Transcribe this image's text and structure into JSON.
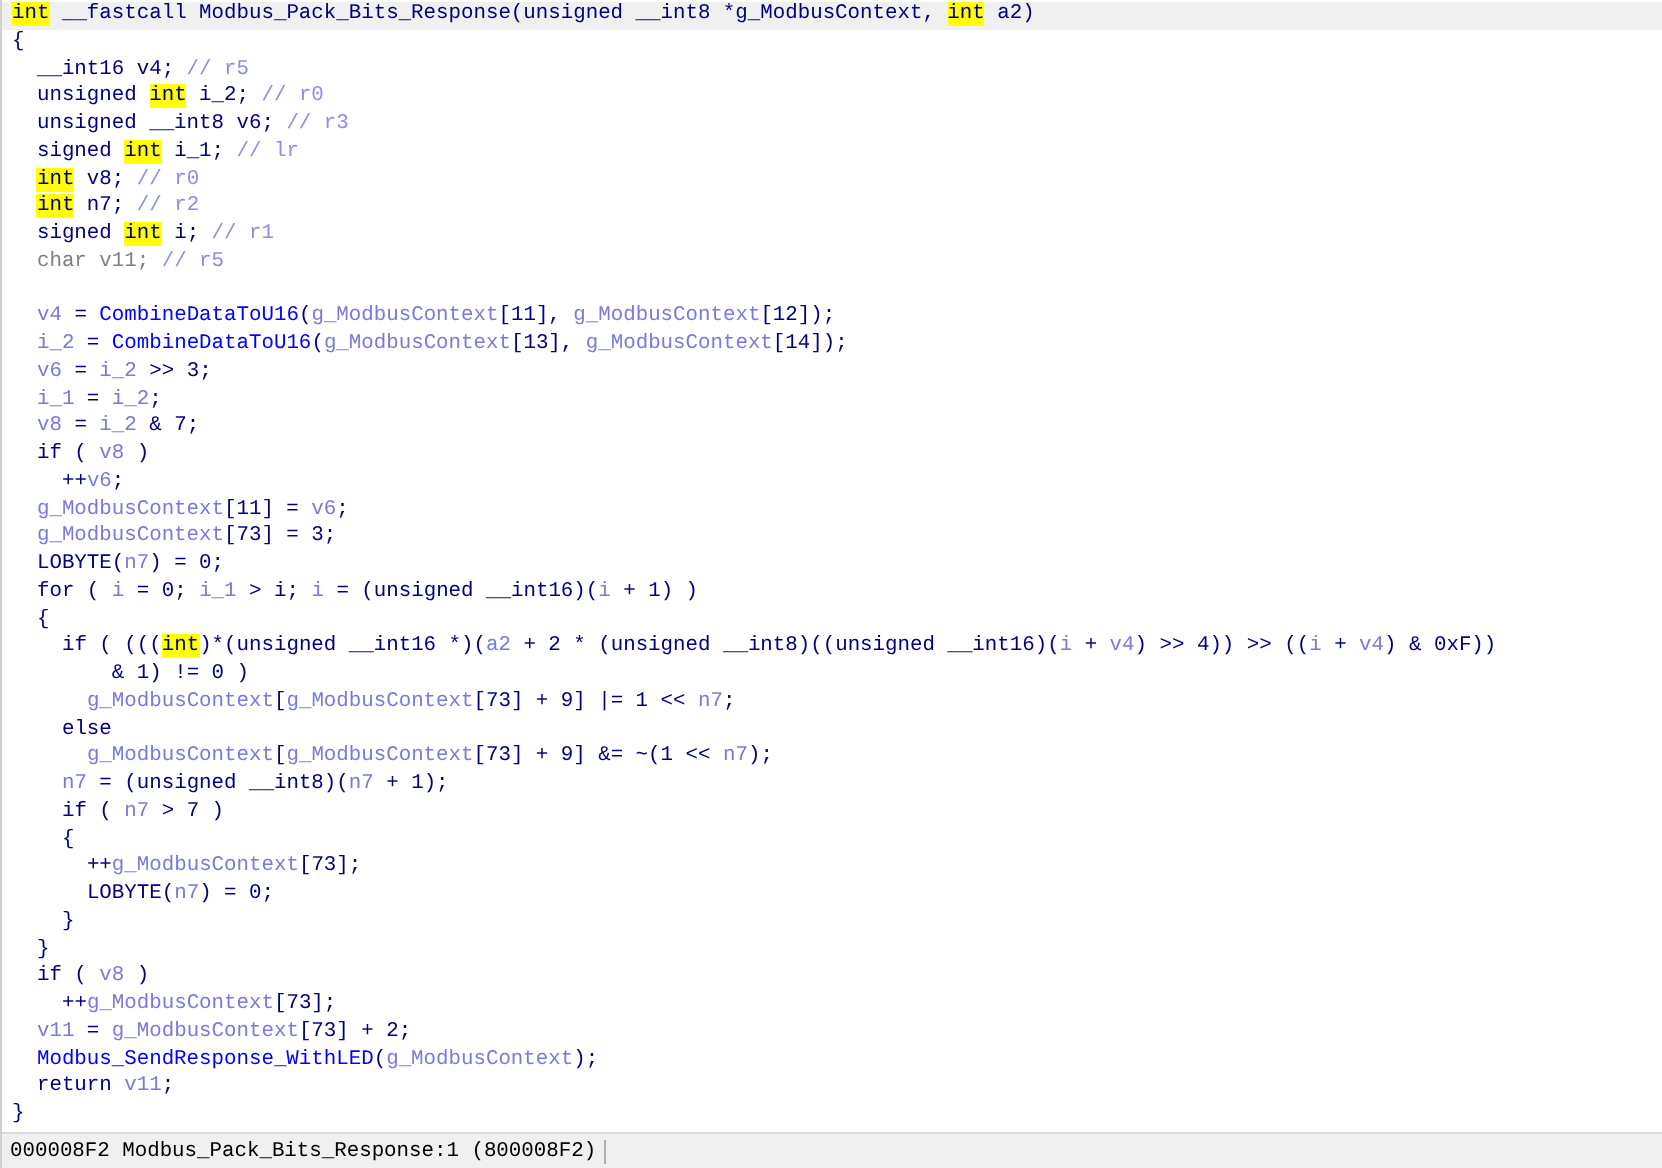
{
  "signature": {
    "selected": true,
    "tokens": [
      {
        "kind": "hl",
        "text": "int"
      },
      {
        "kind": "plain",
        "text": " __fastcall Modbus_Pack_Bits_Response(unsigned __int8 *g_ModbusContext, "
      },
      {
        "kind": "hl",
        "text": "int"
      },
      {
        "kind": "plain",
        "text": " a2)"
      }
    ]
  },
  "lines": [
    {
      "kind": "code",
      "tokens": [
        {
          "kind": "plain",
          "text": "{"
        }
      ],
      "children": [
        {
          "kind": "code",
          "tokens": [
            {
              "kind": "plain",
              "text": "__int16 v4; "
            },
            {
              "kind": "comment",
              "text": "// r5"
            }
          ]
        },
        {
          "kind": "code",
          "tokens": [
            {
              "kind": "plain",
              "text": "unsigned "
            },
            {
              "kind": "hl",
              "text": "int"
            },
            {
              "kind": "plain",
              "text": " i_2; "
            },
            {
              "kind": "comment",
              "text": "// r0"
            }
          ]
        },
        {
          "kind": "code",
          "tokens": [
            {
              "kind": "plain",
              "text": "unsigned __int8 v6; "
            },
            {
              "kind": "comment",
              "text": "// r3"
            }
          ]
        },
        {
          "kind": "code",
          "tokens": [
            {
              "kind": "plain",
              "text": "signed "
            },
            {
              "kind": "hl",
              "text": "int"
            },
            {
              "kind": "plain",
              "text": " i_1; "
            },
            {
              "kind": "comment",
              "text": "// lr"
            }
          ]
        },
        {
          "kind": "code",
          "tokens": [
            {
              "kind": "hl",
              "text": "int"
            },
            {
              "kind": "plain",
              "text": " v8; "
            },
            {
              "kind": "comment",
              "text": "// r0"
            }
          ]
        },
        {
          "kind": "code",
          "tokens": [
            {
              "kind": "hl",
              "text": "int"
            },
            {
              "kind": "plain",
              "text": " n7; "
            },
            {
              "kind": "comment",
              "text": "// r2"
            }
          ]
        },
        {
          "kind": "code",
          "tokens": [
            {
              "kind": "plain",
              "text": "signed "
            },
            {
              "kind": "hl",
              "text": "int"
            },
            {
              "kind": "plain",
              "text": " i; "
            },
            {
              "kind": "comment",
              "text": "// r1"
            }
          ]
        },
        {
          "kind": "code",
          "tokens": [
            {
              "kind": "dim",
              "text": "char v11; "
            },
            {
              "kind": "comment",
              "text": "// r5"
            }
          ]
        },
        {
          "kind": "blank"
        },
        {
          "kind": "code",
          "tokens": [
            {
              "kind": "var",
              "text": "v4"
            },
            {
              "kind": "plain",
              "text": " = "
            },
            {
              "kind": "func",
              "text": "CombineDataToU16"
            },
            {
              "kind": "plain",
              "text": "("
            },
            {
              "kind": "var",
              "text": "g_ModbusContext"
            },
            {
              "kind": "plain",
              "text": "[11], "
            },
            {
              "kind": "var",
              "text": "g_ModbusContext"
            },
            {
              "kind": "plain",
              "text": "[12]);"
            }
          ]
        },
        {
          "kind": "code",
          "tokens": [
            {
              "kind": "var",
              "text": "i_2"
            },
            {
              "kind": "plain",
              "text": " = "
            },
            {
              "kind": "func",
              "text": "CombineDataToU16"
            },
            {
              "kind": "plain",
              "text": "("
            },
            {
              "kind": "var",
              "text": "g_ModbusContext"
            },
            {
              "kind": "plain",
              "text": "[13], "
            },
            {
              "kind": "var",
              "text": "g_ModbusContext"
            },
            {
              "kind": "plain",
              "text": "[14]);"
            }
          ]
        },
        {
          "kind": "code",
          "tokens": [
            {
              "kind": "var",
              "text": "v6"
            },
            {
              "kind": "plain",
              "text": " = "
            },
            {
              "kind": "var",
              "text": "i_2"
            },
            {
              "kind": "plain",
              "text": " >> 3;"
            }
          ]
        },
        {
          "kind": "code",
          "tokens": [
            {
              "kind": "var",
              "text": "i_1"
            },
            {
              "kind": "plain",
              "text": " = "
            },
            {
              "kind": "var",
              "text": "i_2"
            },
            {
              "kind": "plain",
              "text": ";"
            }
          ]
        },
        {
          "kind": "code",
          "tokens": [
            {
              "kind": "var",
              "text": "v8"
            },
            {
              "kind": "plain",
              "text": " = "
            },
            {
              "kind": "var",
              "text": "i_2"
            },
            {
              "kind": "plain",
              "text": " & 7;"
            }
          ]
        },
        {
          "kind": "code",
          "tokens": [
            {
              "kind": "plain",
              "text": "if ( "
            },
            {
              "kind": "var",
              "text": "v8"
            },
            {
              "kind": "plain",
              "text": " )"
            }
          ],
          "children": [
            {
              "kind": "code",
              "tokens": [
                {
                  "kind": "plain",
                  "text": "++"
                },
                {
                  "kind": "var",
                  "text": "v6"
                },
                {
                  "kind": "plain",
                  "text": ";"
                }
              ]
            }
          ]
        },
        {
          "kind": "code",
          "tokens": [
            {
              "kind": "var",
              "text": "g_ModbusContext"
            },
            {
              "kind": "plain",
              "text": "[11] = "
            },
            {
              "kind": "var",
              "text": "v6"
            },
            {
              "kind": "plain",
              "text": ";"
            }
          ]
        },
        {
          "kind": "code",
          "tokens": [
            {
              "kind": "var",
              "text": "g_ModbusContext"
            },
            {
              "kind": "plain",
              "text": "[73] = 3;"
            }
          ]
        },
        {
          "kind": "code",
          "tokens": [
            {
              "kind": "plain",
              "text": "LOBYTE("
            },
            {
              "kind": "var",
              "text": "n7"
            },
            {
              "kind": "plain",
              "text": ") = 0;"
            }
          ]
        },
        {
          "kind": "code",
          "tokens": [
            {
              "kind": "plain",
              "text": "for ( "
            },
            {
              "kind": "var",
              "text": "i"
            },
            {
              "kind": "plain",
              "text": " = 0; "
            },
            {
              "kind": "var",
              "text": "i_1"
            },
            {
              "kind": "plain",
              "text": " > i; "
            },
            {
              "kind": "var",
              "text": "i"
            },
            {
              "kind": "plain",
              "text": " = (unsigned __int16)("
            },
            {
              "kind": "var",
              "text": "i"
            },
            {
              "kind": "plain",
              "text": " + 1) )"
            }
          ]
        },
        {
          "kind": "code",
          "tokens": [
            {
              "kind": "plain",
              "text": "{"
            }
          ],
          "children": [
            {
              "kind": "code",
              "tokens": [
                {
                  "kind": "plain",
                  "text": "if ( ((("
                },
                {
                  "kind": "hl",
                  "text": "int"
                },
                {
                  "kind": "plain",
                  "text": ")*(unsigned __int16 *)("
                },
                {
                  "kind": "var",
                  "text": "a2"
                },
                {
                  "kind": "plain",
                  "text": " + 2 * (unsigned __int8)((unsigned __int16)("
                },
                {
                  "kind": "var",
                  "text": "i"
                },
                {
                  "kind": "plain",
                  "text": " + "
                },
                {
                  "kind": "var",
                  "text": "v4"
                },
                {
                  "kind": "plain",
                  "text": ") >> 4)) >> (("
                },
                {
                  "kind": "var",
                  "text": "i"
                },
                {
                  "kind": "plain",
                  "text": " + "
                },
                {
                  "kind": "var",
                  "text": "v4"
                },
                {
                  "kind": "plain",
                  "text": ") & 0xF))"
                }
              ],
              "children": [
                {
                  "kind": "code",
                  "tokens": [
                    {
                      "kind": "plain",
                      "text": "  & 1) != 0 )"
                    }
                  ]
                },
                {
                  "kind": "code",
                  "tokens": [
                    {
                      "kind": "var",
                      "text": "g_ModbusContext"
                    },
                    {
                      "kind": "plain",
                      "text": "["
                    },
                    {
                      "kind": "var",
                      "text": "g_ModbusContext"
                    },
                    {
                      "kind": "plain",
                      "text": "[73] + 9] |= 1 << "
                    },
                    {
                      "kind": "var",
                      "text": "n7"
                    },
                    {
                      "kind": "plain",
                      "text": ";"
                    }
                  ]
                }
              ]
            },
            {
              "kind": "code",
              "tokens": [
                {
                  "kind": "plain",
                  "text": "else"
                }
              ],
              "children": [
                {
                  "kind": "code",
                  "tokens": [
                    {
                      "kind": "var",
                      "text": "g_ModbusContext"
                    },
                    {
                      "kind": "plain",
                      "text": "["
                    },
                    {
                      "kind": "var",
                      "text": "g_ModbusContext"
                    },
                    {
                      "kind": "plain",
                      "text": "[73] + 9] &= ~(1 << "
                    },
                    {
                      "kind": "var",
                      "text": "n7"
                    },
                    {
                      "kind": "plain",
                      "text": ");"
                    }
                  ]
                }
              ]
            },
            {
              "kind": "code",
              "tokens": [
                {
                  "kind": "var",
                  "text": "n7"
                },
                {
                  "kind": "plain",
                  "text": " = (unsigned __int8)("
                },
                {
                  "kind": "var",
                  "text": "n7"
                },
                {
                  "kind": "plain",
                  "text": " + 1);"
                }
              ]
            },
            {
              "kind": "code",
              "tokens": [
                {
                  "kind": "plain",
                  "text": "if ( "
                },
                {
                  "kind": "var",
                  "text": "n7"
                },
                {
                  "kind": "plain",
                  "text": " > 7 )"
                }
              ]
            },
            {
              "kind": "code",
              "tokens": [
                {
                  "kind": "plain",
                  "text": "{"
                }
              ],
              "children": [
                {
                  "kind": "code",
                  "tokens": [
                    {
                      "kind": "plain",
                      "text": "++"
                    },
                    {
                      "kind": "var",
                      "text": "g_ModbusContext"
                    },
                    {
                      "kind": "plain",
                      "text": "[73];"
                    }
                  ]
                },
                {
                  "kind": "code",
                  "tokens": [
                    {
                      "kind": "plain",
                      "text": "LOBYTE("
                    },
                    {
                      "kind": "var",
                      "text": "n7"
                    },
                    {
                      "kind": "plain",
                      "text": ") = 0;"
                    }
                  ]
                }
              ]
            },
            {
              "kind": "code",
              "tokens": [
                {
                  "kind": "plain",
                  "text": "}"
                }
              ]
            }
          ]
        },
        {
          "kind": "code",
          "tokens": [
            {
              "kind": "plain",
              "text": "}"
            }
          ]
        },
        {
          "kind": "code",
          "tokens": [
            {
              "kind": "plain",
              "text": "if ( "
            },
            {
              "kind": "var",
              "text": "v8"
            },
            {
              "kind": "plain",
              "text": " )"
            }
          ],
          "children": [
            {
              "kind": "code",
              "tokens": [
                {
                  "kind": "plain",
                  "text": "++"
                },
                {
                  "kind": "var",
                  "text": "g_ModbusContext"
                },
                {
                  "kind": "plain",
                  "text": "[73];"
                }
              ]
            }
          ]
        },
        {
          "kind": "code",
          "tokens": [
            {
              "kind": "var",
              "text": "v11"
            },
            {
              "kind": "plain",
              "text": " = "
            },
            {
              "kind": "var",
              "text": "g_ModbusContext"
            },
            {
              "kind": "plain",
              "text": "[73] + 2;"
            }
          ]
        },
        {
          "kind": "code",
          "tokens": [
            {
              "kind": "func",
              "text": "Modbus_SendResponse_WithLED"
            },
            {
              "kind": "plain",
              "text": "("
            },
            {
              "kind": "var",
              "text": "g_ModbusContext"
            },
            {
              "kind": "plain",
              "text": ");"
            }
          ]
        },
        {
          "kind": "code",
          "tokens": [
            {
              "kind": "plain",
              "text": "return "
            },
            {
              "kind": "var",
              "text": "v11"
            },
            {
              "kind": "plain",
              "text": ";"
            }
          ]
        }
      ]
    },
    {
      "kind": "code",
      "tokens": [
        {
          "kind": "plain",
          "text": "}"
        }
      ]
    }
  ],
  "status_bar": {
    "location": "000008F2 Modbus_Pack_Bits_Response:1 (800008F2)"
  }
}
